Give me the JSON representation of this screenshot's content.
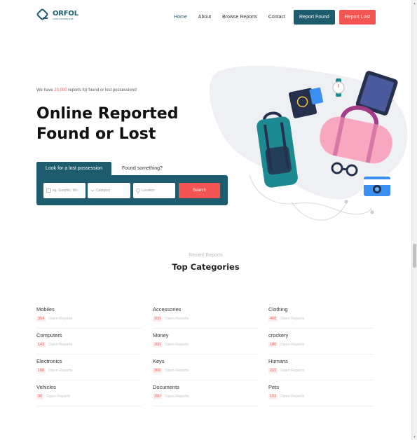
{
  "brand": {
    "name": "ORFOL",
    "tagline": "LOSS & FOUND HUB"
  },
  "nav": {
    "links": [
      "Home",
      "About",
      "Browse Reports",
      "Contact"
    ],
    "report_found": "Report Found",
    "report_lost": "Report Lost"
  },
  "hero": {
    "kicker_prefix": "We have ",
    "kicker_count": "20,000",
    "kicker_suffix": " reports for found or lost possessions!",
    "title_line1": "Online Reported",
    "title_line2": "Found or Lost"
  },
  "search": {
    "tab_active": "Look for a lost possession",
    "tab_other": "Found something?",
    "keyword_placeholder": "eg. Garphic. Wo",
    "category_placeholder": "Category",
    "location_placeholder": "Location",
    "button": "Search"
  },
  "categories_section": {
    "subtitle": "Recent Reports",
    "title": "Top Categories",
    "open_label": "Open Reports",
    "items": [
      {
        "name": "Mobiles",
        "count": "354"
      },
      {
        "name": "Accessories",
        "count": "100"
      },
      {
        "name": "Clothing",
        "count": "460"
      },
      {
        "name": "Computers",
        "count": "143"
      },
      {
        "name": "Money",
        "count": "200"
      },
      {
        "name": "crockery",
        "count": "100"
      },
      {
        "name": "Electronics",
        "count": "100"
      },
      {
        "name": "Keys",
        "count": "300"
      },
      {
        "name": "Humans",
        "count": "222"
      },
      {
        "name": "Vehicles",
        "count": "90"
      },
      {
        "name": "Documents",
        "count": "150"
      },
      {
        "name": "Pets",
        "count": "123"
      }
    ]
  },
  "colors": {
    "primary": "#1d5b6f",
    "accent": "#f35555"
  }
}
